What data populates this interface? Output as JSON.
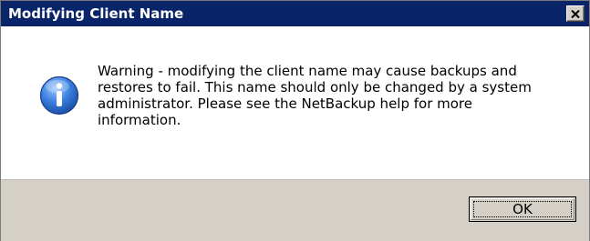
{
  "window": {
    "title": "Modifying Client Name",
    "close_icon": "close-icon"
  },
  "dialog": {
    "icon": "info-icon",
    "message": "Warning - modifying the client name may cause backups and\nrestores to fail.  This name should only be changed by a system\nadministrator.  Please see the NetBackup help for more\ninformation."
  },
  "buttons": {
    "ok_label": "OK"
  },
  "colors": {
    "titlebar": "#0a246a",
    "title_text": "#ffffff",
    "footer": "#d4d0c8",
    "icon_blue": "#2f6fcb"
  }
}
